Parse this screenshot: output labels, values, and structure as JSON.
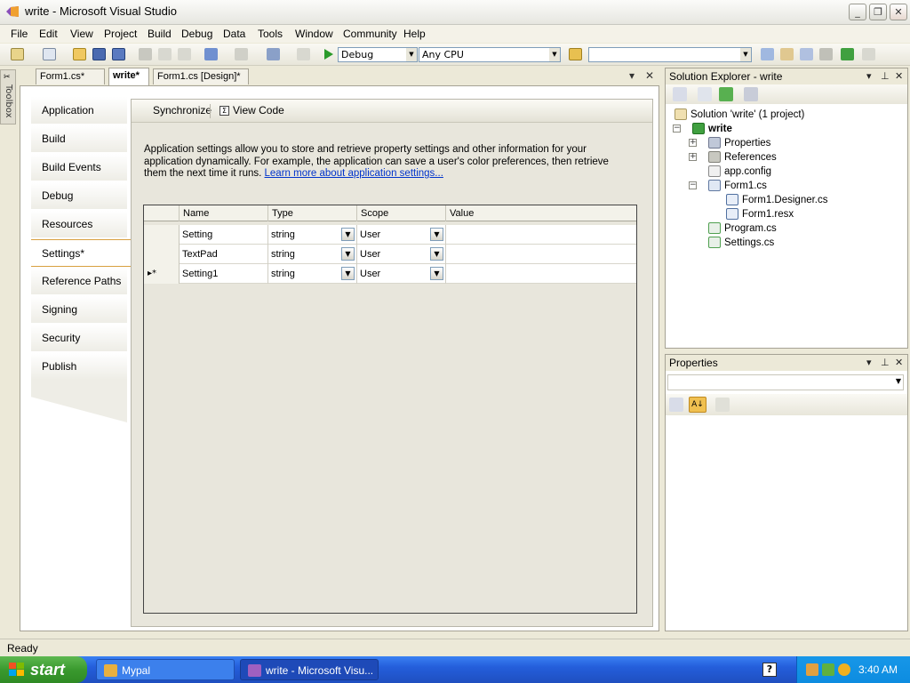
{
  "window": {
    "title": "write - Microsoft Visual Studio"
  },
  "menu": [
    "File",
    "Edit",
    "View",
    "Project",
    "Build",
    "Debug",
    "Data",
    "Tools",
    "Window",
    "Community",
    "Help"
  ],
  "toolbar": {
    "configuration": "Debug",
    "platform": "Any CPU",
    "search_value": ""
  },
  "toolbox": {
    "label": "Toolbox"
  },
  "doc_tabs": [
    "Form1.cs*",
    "write*",
    "Form1.cs [Design]*"
  ],
  "designer": {
    "nav": [
      "Application",
      "Build",
      "Build Events",
      "Debug",
      "Resources",
      "Settings*",
      "Reference Paths",
      "Signing",
      "Security",
      "Publish"
    ],
    "toolbar": {
      "synchronize": "Synchronize",
      "view_code": "View Code"
    },
    "description": "Application settings allow you to store and retrieve property settings and other information for your application dynamically. For example, the application can save a user's color preferences, then retrieve them the next time it runs. ",
    "learn_more": "Learn more about application settings...",
    "grid": {
      "columns": [
        "Name",
        "Type",
        "Scope",
        "Value"
      ],
      "rows": [
        {
          "marker": "",
          "name": "Setting",
          "type": "string",
          "scope": "User",
          "value": ""
        },
        {
          "marker": "",
          "name": "TextPad",
          "type": "string",
          "scope": "User",
          "value": ""
        },
        {
          "marker": "▸*",
          "name": "Setting1",
          "type": "string",
          "scope": "User",
          "value": ""
        }
      ]
    }
  },
  "solution_explorer": {
    "title": "Solution Explorer - write",
    "items": [
      {
        "label": "Solution 'write' (1 project)",
        "icon": "solution-icon"
      },
      {
        "label": "write",
        "icon": "project-icon"
      },
      {
        "label": "Properties",
        "icon": "properties-folder-icon"
      },
      {
        "label": "References",
        "icon": "references-folder-icon"
      },
      {
        "label": "app.config",
        "icon": "config-file-icon"
      },
      {
        "label": "Form1.cs",
        "icon": "form-icon"
      },
      {
        "label": "Form1.Designer.cs",
        "icon": "csharp-file-icon"
      },
      {
        "label": "Form1.resx",
        "icon": "resx-file-icon"
      },
      {
        "label": "Program.cs",
        "icon": "csharp-file-icon"
      },
      {
        "label": "Settings.cs",
        "icon": "csharp-file-icon"
      }
    ]
  },
  "properties": {
    "title": "Properties",
    "object_value": ""
  },
  "status": {
    "text": "Ready"
  },
  "taskbar": {
    "start": "start",
    "tasks": [
      "Mypal",
      "write - Microsoft Visu..."
    ],
    "clock": "3:40 AM"
  }
}
